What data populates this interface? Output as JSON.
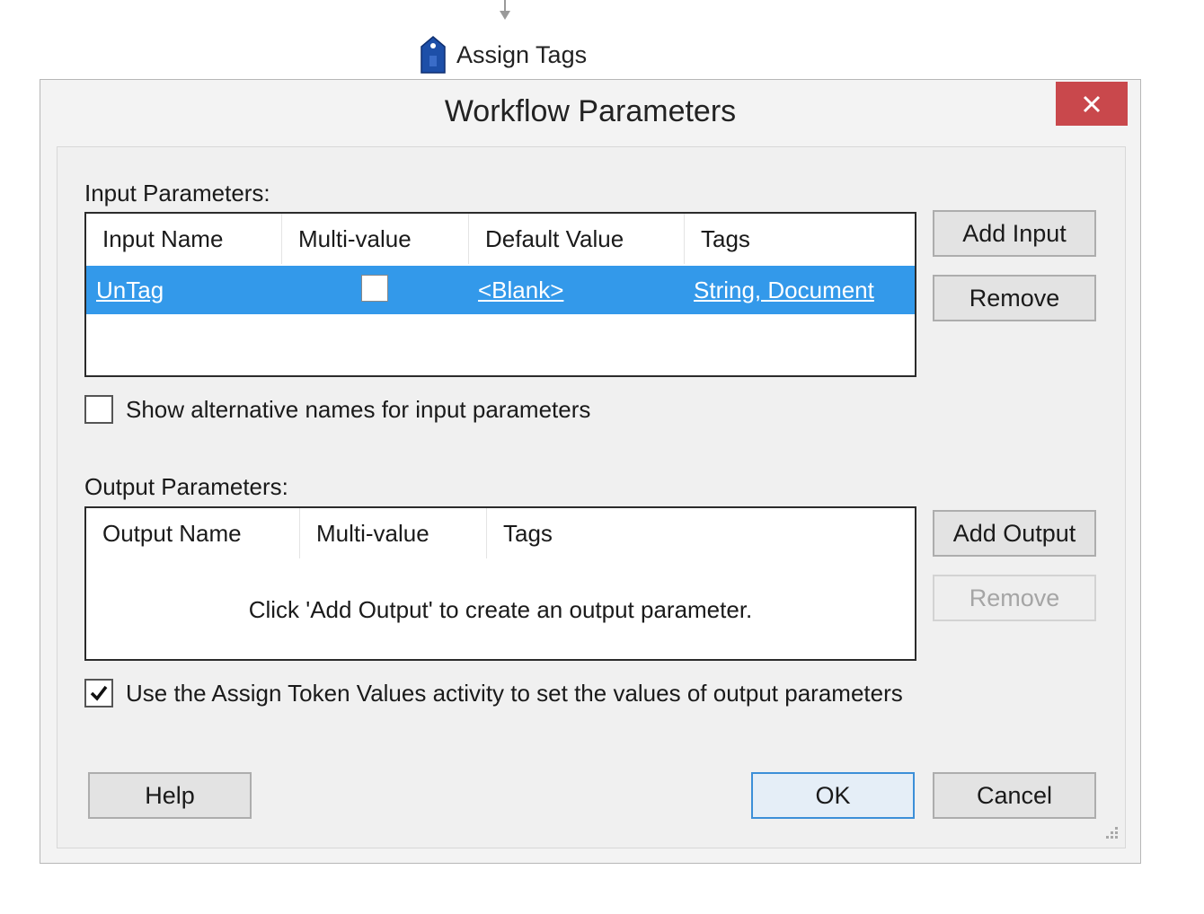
{
  "workflow": {
    "activity_label": "Assign Tags",
    "activity_icon": "tag-icon"
  },
  "dialog": {
    "title": "Workflow Parameters",
    "close_icon": "close-icon",
    "close_color": "#c9484c"
  },
  "input_section": {
    "label": "Input Parameters:",
    "columns": [
      "Input Name",
      "Multi-value",
      "Default Value",
      "Tags"
    ],
    "rows": [
      {
        "name": "UnTag",
        "multi_value": false,
        "default_value": "<Blank>",
        "tags": "String, Document"
      }
    ],
    "selected_row_color": "#3399ea",
    "add_button": "Add Input",
    "remove_button": "Remove",
    "alt_names_label": "Show alternative names for input parameters",
    "alt_names_checked": false
  },
  "output_section": {
    "label": "Output Parameters:",
    "columns": [
      "Output Name",
      "Multi-value",
      "Tags"
    ],
    "empty_message": "Click 'Add Output' to create an output parameter.",
    "add_button": "Add Output",
    "remove_button": "Remove",
    "remove_enabled": false,
    "assign_token_label": "Use the Assign Token Values activity to set the values of output parameters",
    "assign_token_checked": true
  },
  "footer": {
    "help": "Help",
    "ok": "OK",
    "cancel": "Cancel"
  }
}
